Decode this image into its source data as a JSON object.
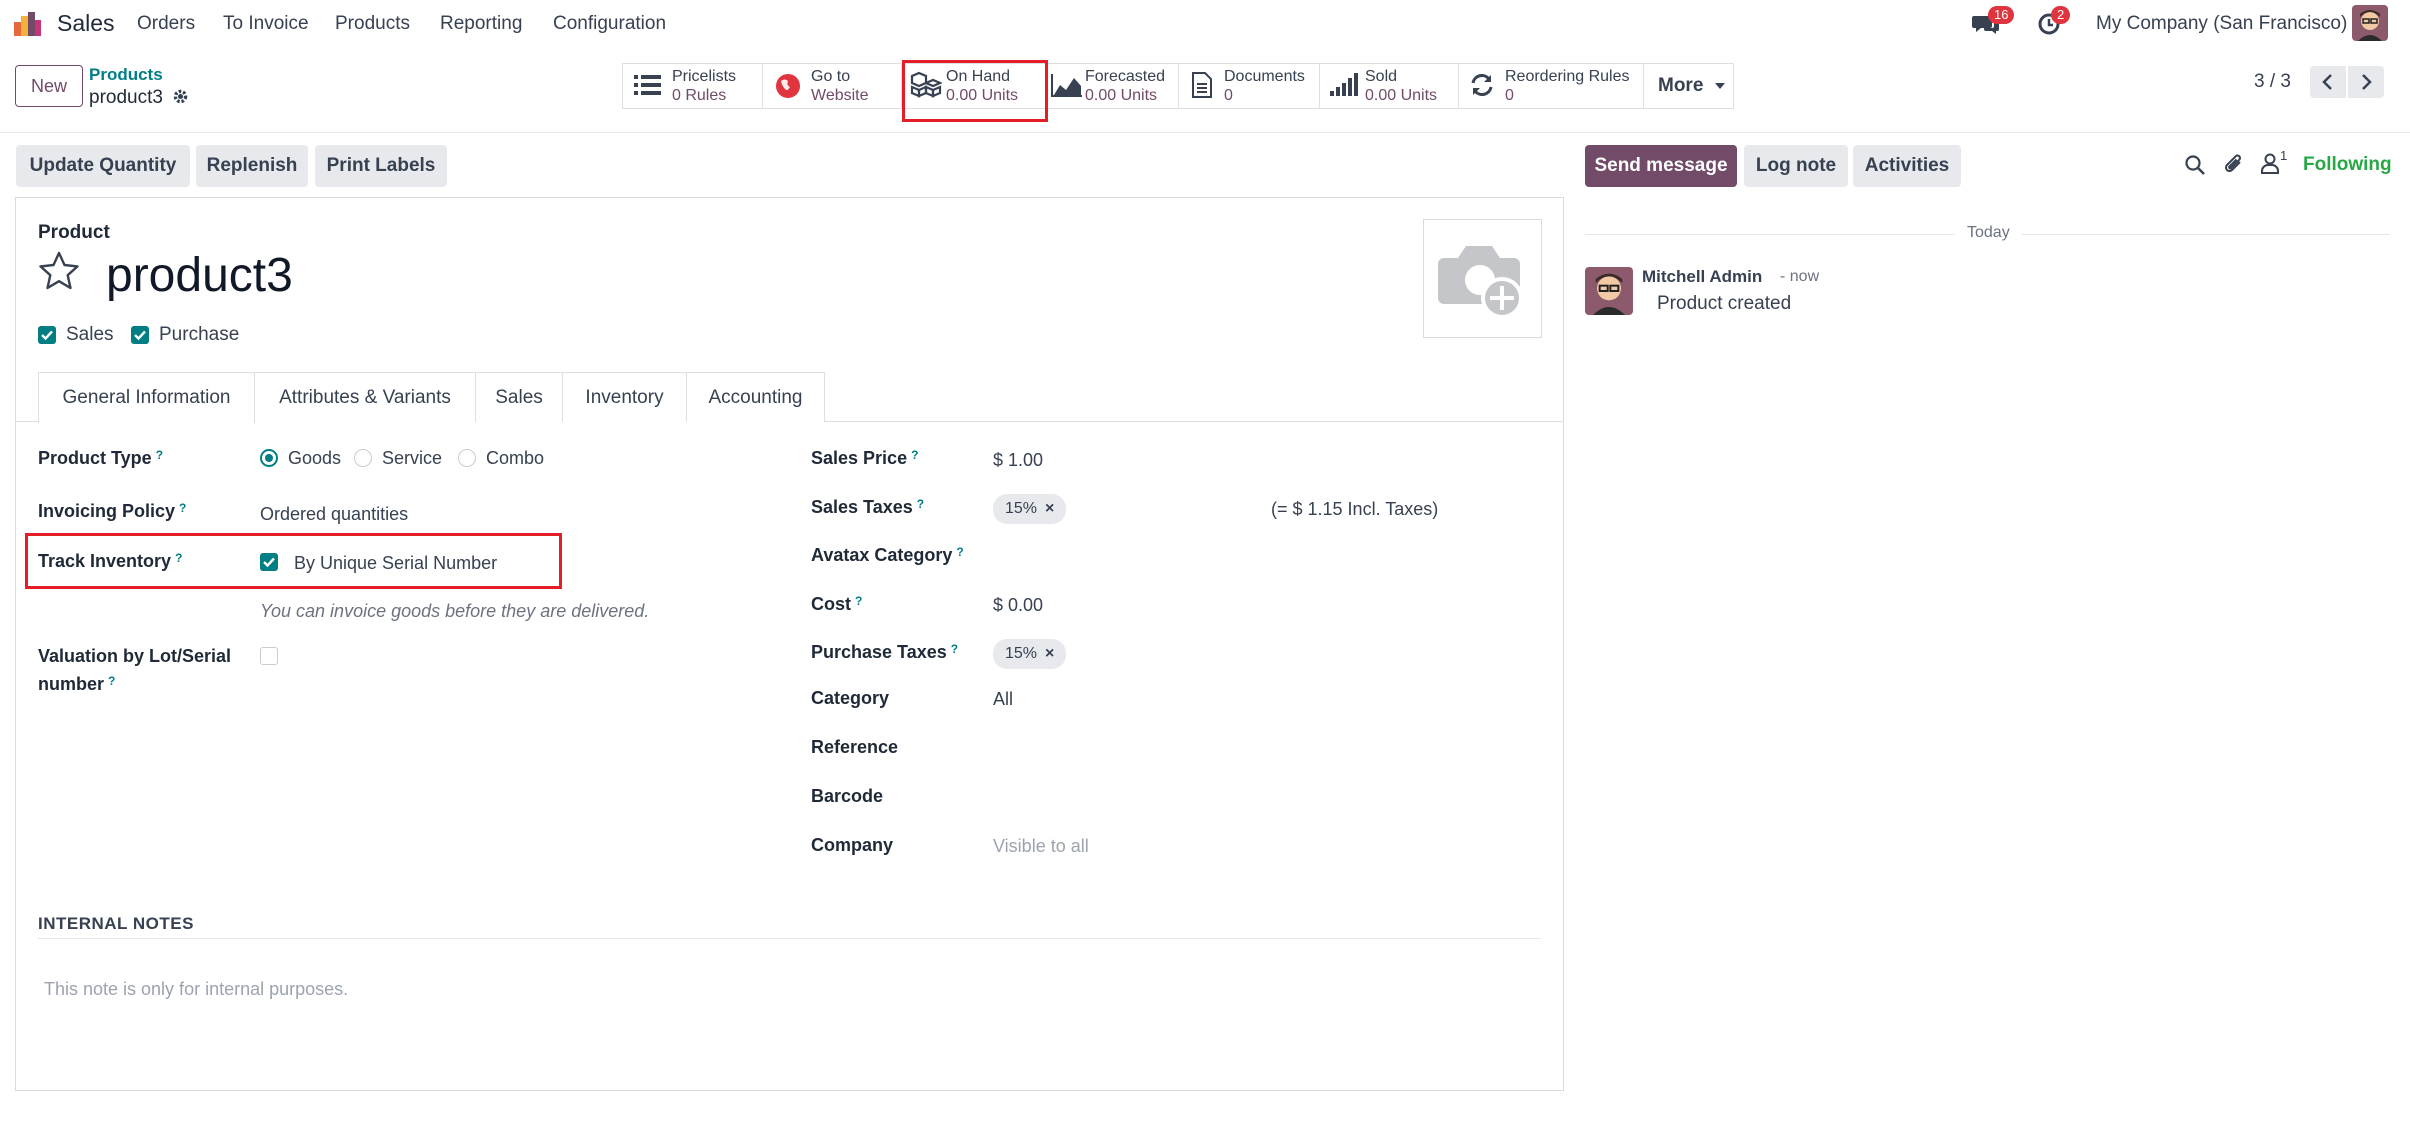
{
  "navbar": {
    "app_name": "Sales",
    "menu": [
      "Orders",
      "To Invoice",
      "Products",
      "Reporting",
      "Configuration"
    ],
    "messages_count": "16",
    "activities_count": "2",
    "company": "My Company (San Francisco)"
  },
  "breadcrumb": {
    "parent": "Products",
    "current": "product3"
  },
  "control": {
    "new_label": "New",
    "pager": "3 / 3"
  },
  "smart_buttons": [
    {
      "icon": "list-icon",
      "line1": "Pricelists",
      "line2": "0 Rules"
    },
    {
      "icon": "globe-icon",
      "line1": "Go to",
      "line2": "Website"
    },
    {
      "icon": "cubes-icon",
      "line1": "On Hand",
      "line2": "0.00 Units"
    },
    {
      "icon": "area-chart-icon",
      "line1": "Forecasted",
      "line2": "0.00 Units"
    },
    {
      "icon": "document-icon",
      "line1": "Documents",
      "line2": "0"
    },
    {
      "icon": "signal-icon",
      "line1": "Sold",
      "line2": "0.00 Units"
    },
    {
      "icon": "refresh-icon",
      "line1": "Reordering Rules",
      "line2": "0"
    }
  ],
  "more_label": "More",
  "action_buttons": {
    "update_quantity": "Update Quantity",
    "replenish": "Replenish",
    "print_labels": "Print Labels"
  },
  "chatter": {
    "send_message": "Send message",
    "log_note": "Log note",
    "activities": "Activities",
    "followers_count": "1",
    "following": "Following",
    "date_separator": "Today",
    "message": {
      "author": "Mitchell Admin",
      "time": "- now",
      "body": "Product created"
    }
  },
  "form": {
    "kind_label": "Product",
    "name": "product3",
    "sales_label": "Sales",
    "purchase_label": "Purchase",
    "tabs": [
      "General Information",
      "Attributes & Variants",
      "Sales",
      "Inventory",
      "Accounting"
    ],
    "left": {
      "product_type": {
        "label": "Product Type",
        "options": [
          "Goods",
          "Service",
          "Combo"
        ]
      },
      "invoicing_policy": {
        "label": "Invoicing Policy",
        "value": "Ordered quantities"
      },
      "track_inventory": {
        "label": "Track Inventory",
        "value": "By Unique Serial Number"
      },
      "hint": "You can invoice goods before they are delivered.",
      "valuation": {
        "label_line1": "Valuation by Lot/Serial",
        "label_line2": "number"
      }
    },
    "right": {
      "sales_price": {
        "label": "Sales Price",
        "value": "$ 1.00"
      },
      "sales_taxes": {
        "label": "Sales Taxes",
        "tag": "15%",
        "incl": "(= $ 1.15 Incl. Taxes)"
      },
      "avatax_category": {
        "label": "Avatax Category"
      },
      "cost": {
        "label": "Cost",
        "value": "$ 0.00"
      },
      "purchase_taxes": {
        "label": "Purchase Taxes",
        "tag": "15%"
      },
      "category": {
        "label": "Category",
        "value": "All"
      },
      "reference": {
        "label": "Reference"
      },
      "barcode": {
        "label": "Barcode"
      },
      "company": {
        "label": "Company",
        "placeholder": "Visible to all"
      }
    },
    "internal_notes": {
      "label": "INTERNAL NOTES",
      "placeholder": "This note is only for internal purposes."
    }
  },
  "help_mark": "?",
  "colors": {
    "primary": "#714b67",
    "accent": "#017e84",
    "highlight": "#e41e26",
    "badge": "#e0343e"
  }
}
